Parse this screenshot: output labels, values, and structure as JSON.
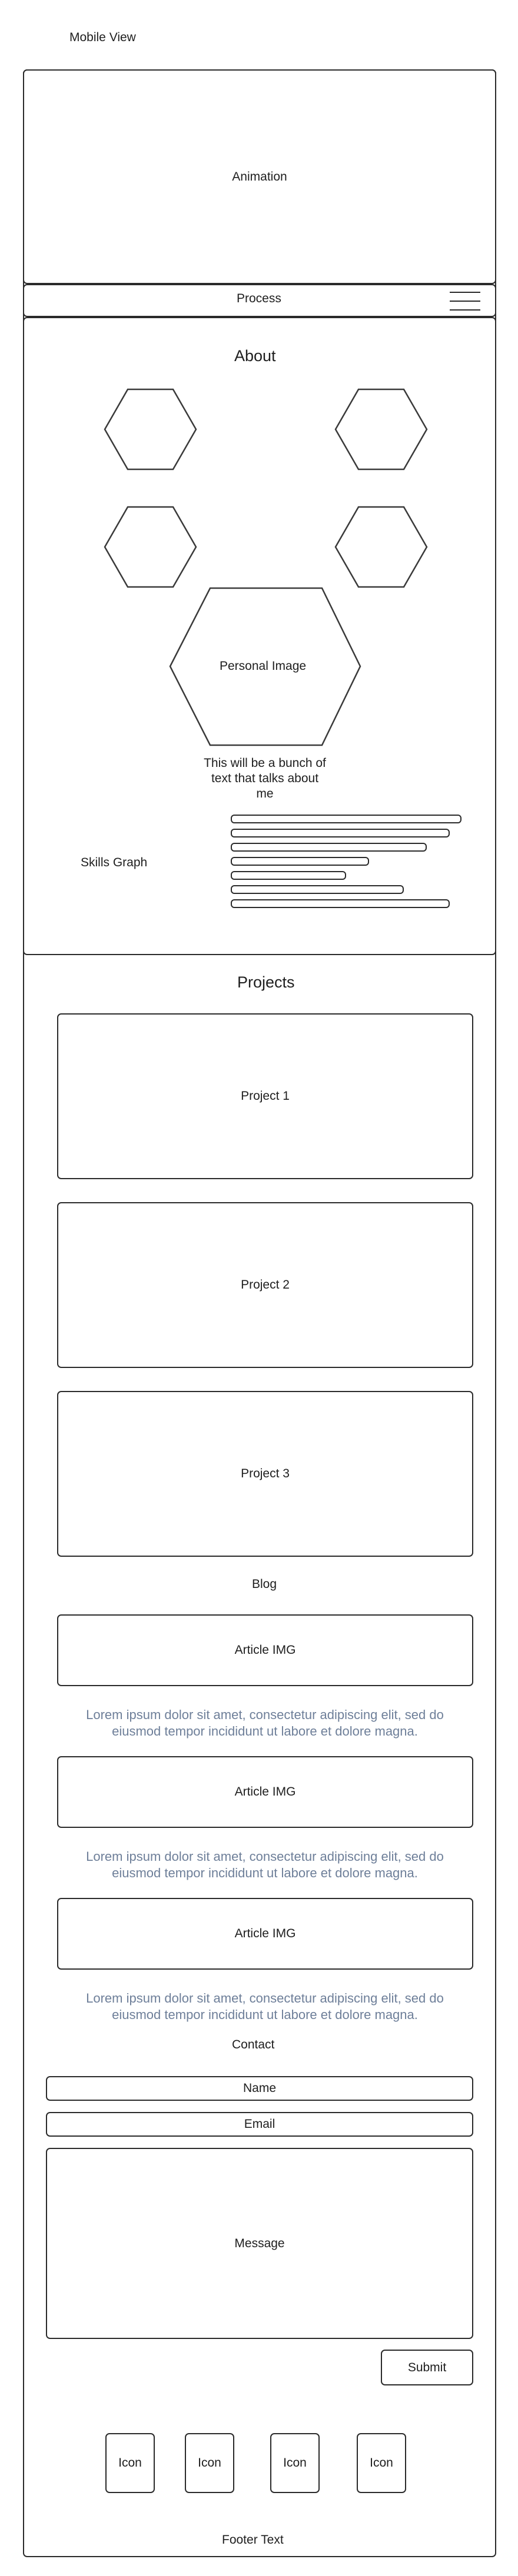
{
  "page": {
    "view_label": "Mobile View"
  },
  "animation": {
    "label": "Animation"
  },
  "nav": {
    "label": "Process",
    "menu_icon": "hamburger-menu-icon"
  },
  "about": {
    "heading": "About",
    "personal_image": "Personal Image",
    "bio_text_lines": [
      "This will be a bunch of",
      "text that talks about",
      "me"
    ],
    "skills_label": "Skills Graph",
    "skill_levels": [
      1.0,
      0.95,
      0.85,
      0.6,
      0.5,
      0.75,
      0.95
    ]
  },
  "projects": {
    "heading": "Projects",
    "items": [
      "Project 1",
      "Project 2",
      "Project 3"
    ]
  },
  "blog": {
    "heading": "Blog",
    "articles": [
      {
        "image": "Article IMG",
        "text_lines": [
          "Lorem ipsum dolor sit amet, consectetur adipiscing elit, sed do",
          "eiusmod tempor incididunt ut labore et dolore magna."
        ]
      },
      {
        "image": "Article IMG",
        "text_lines": [
          "Lorem ipsum dolor sit amet, consectetur adipiscing elit, sed do",
          "eiusmod tempor incididunt ut labore et dolore magna."
        ]
      },
      {
        "image": "Article IMG",
        "text_lines": [
          "Lorem ipsum dolor sit amet, consectetur adipiscing elit, sed do",
          "eiusmod tempor incididunt ut labore et dolore magna."
        ]
      }
    ]
  },
  "contact": {
    "heading": "Contact",
    "name_label": "Name",
    "email_label": "Email",
    "message_label": "Message",
    "submit_label": "Submit",
    "icons": [
      "Icon",
      "Icon",
      "Icon",
      "Icon"
    ]
  },
  "footer": {
    "text": "Footer Text"
  }
}
